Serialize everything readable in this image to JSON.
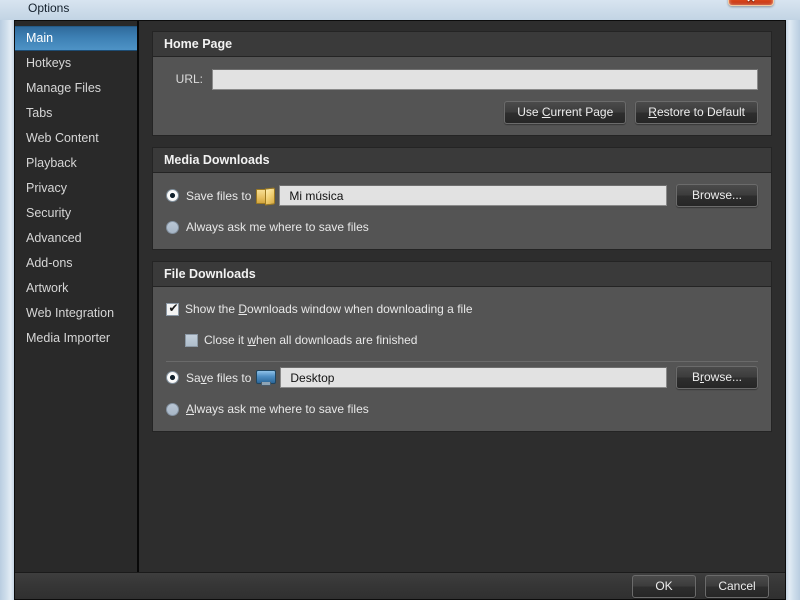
{
  "window": {
    "title": "Options",
    "close_icon": "close-icon",
    "close_glyph": "✕"
  },
  "sidebar": {
    "selected": "Main",
    "items": [
      {
        "label": "Main"
      },
      {
        "label": "Hotkeys"
      },
      {
        "label": "Manage Files"
      },
      {
        "label": "Tabs"
      },
      {
        "label": "Web Content"
      },
      {
        "label": "Playback"
      },
      {
        "label": "Privacy"
      },
      {
        "label": "Security"
      },
      {
        "label": "Advanced"
      },
      {
        "label": "Add-ons"
      },
      {
        "label": "Artwork"
      },
      {
        "label": "Web Integration"
      },
      {
        "label": "Media Importer"
      }
    ]
  },
  "home_page": {
    "title": "Home Page",
    "url_label": "URL:",
    "url_value": "",
    "url_placeholder": "",
    "use_current_page_button": "Use Current Page",
    "use_current_page_accel": "C",
    "restore_default_button": "Restore to Default",
    "restore_default_accel": "R"
  },
  "media_downloads": {
    "title": "Media Downloads",
    "save_files_to_label": "Save files to",
    "save_files_to_selected": true,
    "folder_icon": "folder-icon",
    "path_value": "Mi música",
    "browse_button": "Browse...",
    "always_ask_label": "Always ask me where to save files",
    "always_ask_selected": false
  },
  "file_downloads": {
    "title": "File Downloads",
    "show_downloads_window_label": "Show the Downloads window when downloading a file",
    "show_downloads_window_checked": true,
    "show_downloads_window_accel": "D",
    "close_when_finished_label": "Close it when all downloads are finished",
    "close_when_finished_checked": false,
    "close_when_finished_accel": "w",
    "save_files_to_label": "Save files to",
    "save_files_to_accel": "v",
    "save_files_to_selected": true,
    "monitor_icon": "monitor-icon",
    "path_value": "Desktop",
    "browse_button": "Browse...",
    "browse_accel": "r",
    "always_ask_label": "Always ask me where to save files",
    "always_ask_accel": "A",
    "always_ask_selected": false
  },
  "footer": {
    "ok_button": "OK",
    "cancel_button": "Cancel"
  },
  "colors": {
    "accent_selected": "#3d80b4",
    "dialog_bg": "#2d2d2d",
    "sidebar_bg": "#292929",
    "group_body_bg": "#545454",
    "group_header_bg": "#3a3a3a",
    "field_bg": "#e2e2e2",
    "close_button": "#d8451a"
  }
}
